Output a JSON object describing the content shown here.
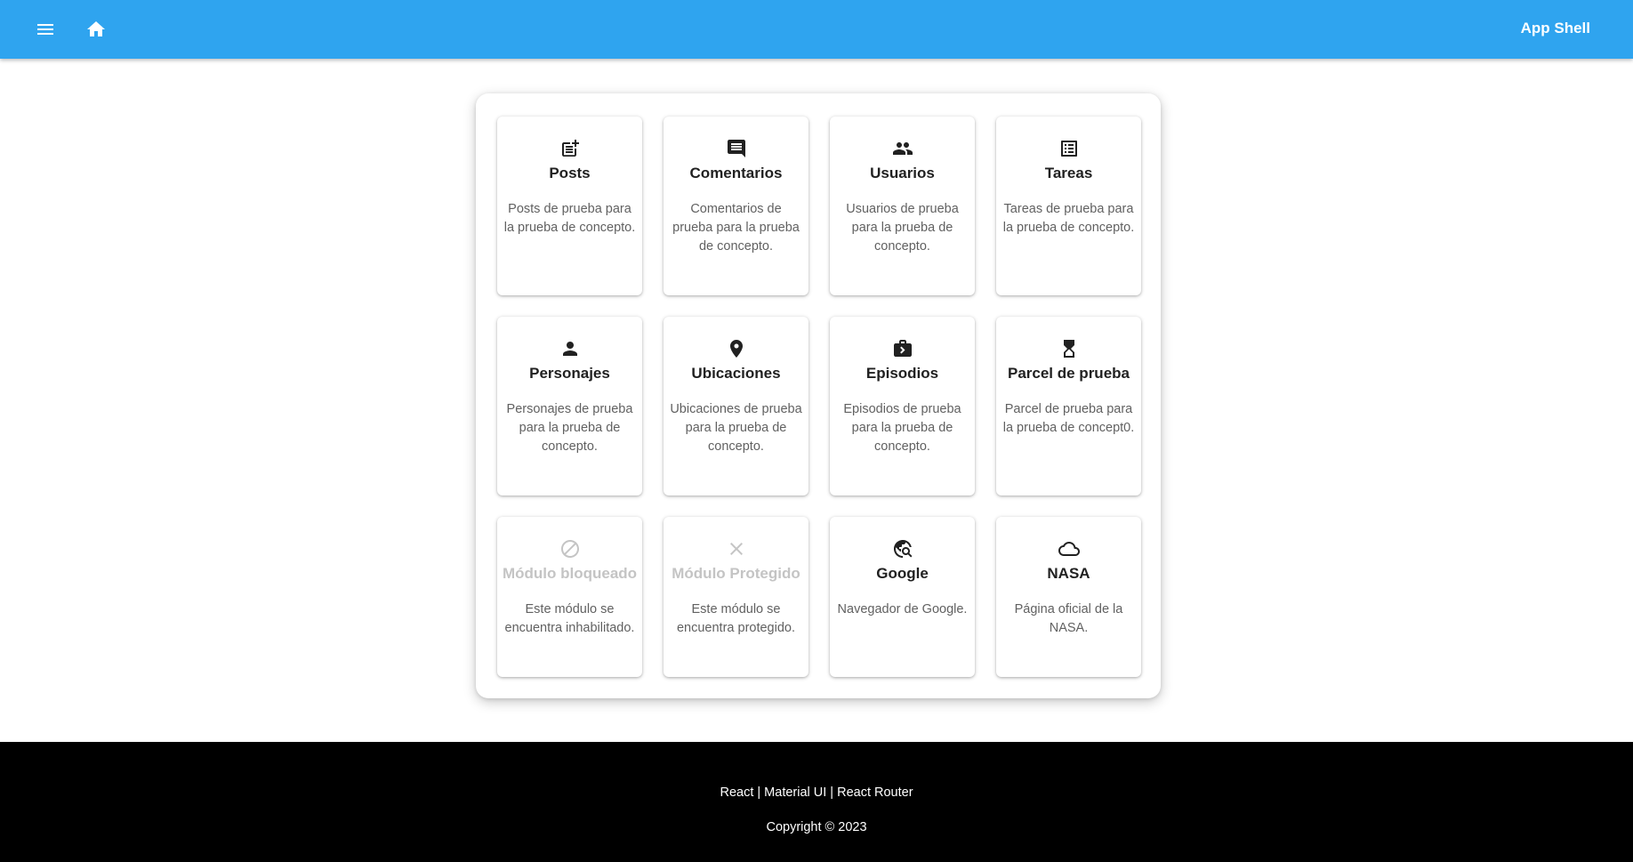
{
  "appbar": {
    "title": "App Shell",
    "menu_icon": "menu-icon",
    "home_icon": "home-icon",
    "color": "#2fa4ef"
  },
  "cards": [
    {
      "icon": "post-add-icon",
      "title": "Posts",
      "description": "Posts de prueba para la prueba de concepto.",
      "disabled": false
    },
    {
      "icon": "comment-icon",
      "title": "Comentarios",
      "description": "Comentarios de prueba para la prueba de concepto.",
      "disabled": false
    },
    {
      "icon": "people-icon",
      "title": "Usuarios",
      "description": "Usuarios de prueba para la prueba de concepto.",
      "disabled": false
    },
    {
      "icon": "list-alt-icon",
      "title": "Tareas",
      "description": "Tareas de prueba para la prueba de concepto.",
      "disabled": false
    },
    {
      "icon": "person-icon",
      "title": "Personajes",
      "description": "Personajes de prueba para la prueba de concepto.",
      "disabled": false
    },
    {
      "icon": "location-pin-icon",
      "title": "Ubicaciones",
      "description": "Ubicaciones de prueba para la prueba de concepto.",
      "disabled": false
    },
    {
      "icon": "work-icon",
      "title": "Episodios",
      "description": "Episodios de prueba para la prueba de concepto.",
      "disabled": false
    },
    {
      "icon": "hourglass-icon",
      "title": "Parcel de prueba",
      "description": "Parcel de prueba para la prueba de concept0.",
      "disabled": false
    },
    {
      "icon": "block-icon",
      "title": "Módulo bloqueado",
      "description": "Este módulo se encuentra inhabilitado.",
      "disabled": true
    },
    {
      "icon": "close-icon",
      "title": "Módulo Protegido",
      "description": "Este módulo se encuentra protegido.",
      "disabled": true
    },
    {
      "icon": "travel-explore-icon",
      "title": "Google",
      "description": "Navegador de Google.",
      "disabled": false
    },
    {
      "icon": "cloud-icon",
      "title": "NASA",
      "description": "Página oficial de la NASA.",
      "disabled": false
    }
  ],
  "footer": {
    "links_text": "React | Material UI | React Router",
    "copyright": "Copyright © 2023"
  }
}
